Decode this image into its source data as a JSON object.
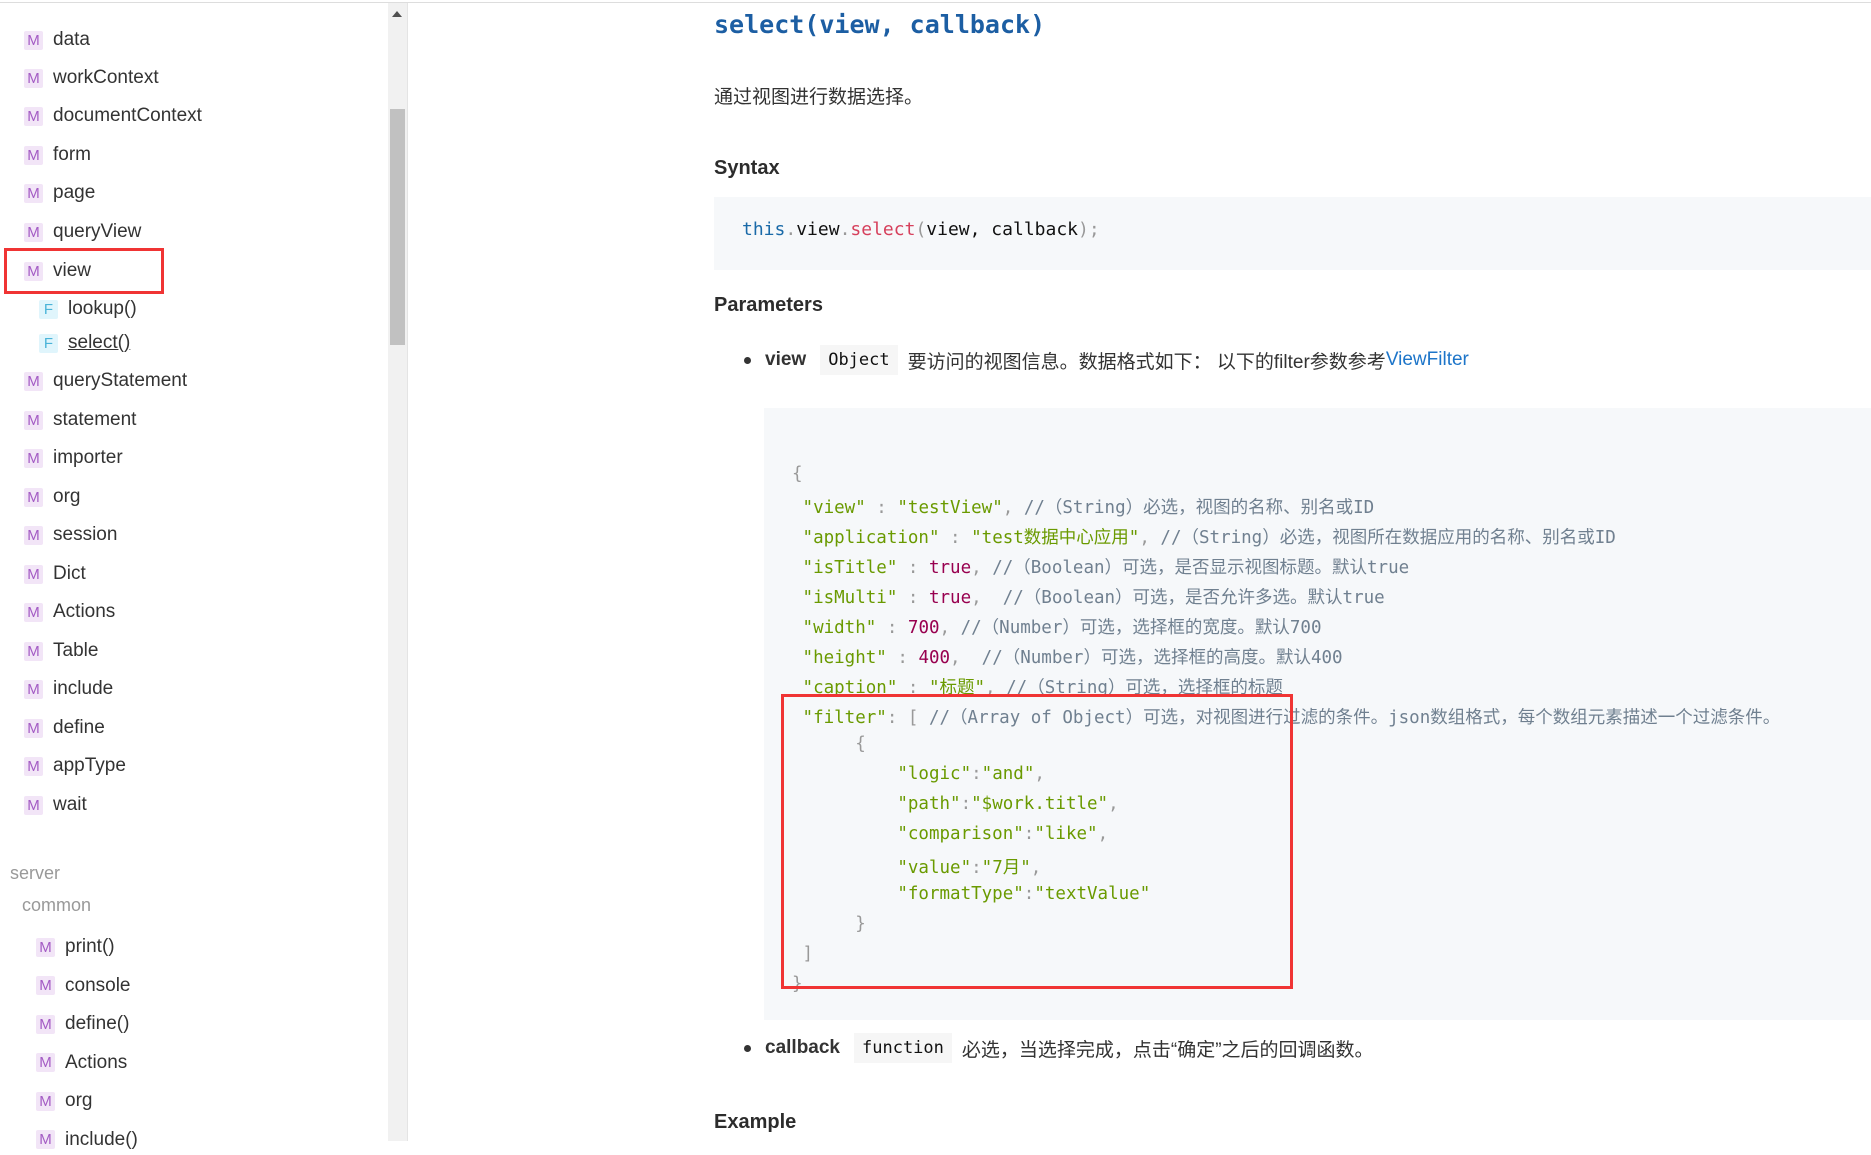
{
  "sidebar": {
    "items": [
      {
        "badge": "M",
        "label": "data"
      },
      {
        "badge": "M",
        "label": "workContext"
      },
      {
        "badge": "M",
        "label": "documentContext"
      },
      {
        "badge": "M",
        "label": "form"
      },
      {
        "badge": "M",
        "label": "page"
      },
      {
        "badge": "M",
        "label": "queryView"
      },
      {
        "badge": "M",
        "label": "view"
      },
      {
        "badge": "F",
        "label": "lookup()"
      },
      {
        "badge": "F",
        "label": "select()"
      },
      {
        "badge": "M",
        "label": "queryStatement"
      },
      {
        "badge": "M",
        "label": "statement"
      },
      {
        "badge": "M",
        "label": "importer"
      },
      {
        "badge": "M",
        "label": "org"
      },
      {
        "badge": "M",
        "label": "session"
      },
      {
        "badge": "M",
        "label": "Dict"
      },
      {
        "badge": "M",
        "label": "Actions"
      },
      {
        "badge": "M",
        "label": "Table"
      },
      {
        "badge": "M",
        "label": "include"
      },
      {
        "badge": "M",
        "label": "define"
      },
      {
        "badge": "M",
        "label": "appType"
      },
      {
        "badge": "M",
        "label": "wait"
      }
    ],
    "server_label": "server",
    "common_label": "common",
    "server_items": [
      {
        "badge": "M",
        "label": "print()"
      },
      {
        "badge": "M",
        "label": "console"
      },
      {
        "badge": "M",
        "label": "define()"
      },
      {
        "badge": "M",
        "label": "Actions"
      },
      {
        "badge": "M",
        "label": "org"
      },
      {
        "badge": "M",
        "label": "include()"
      }
    ],
    "highlight_color": "#f03434"
  },
  "main": {
    "title": "select(view, callback)",
    "description": "通过视图进行数据选择。",
    "syntax_heading": "Syntax",
    "syntax": {
      "this": "this",
      "dot1": ".",
      "obj": "view",
      "dot2": ".",
      "fn": "select",
      "open": "(",
      "args": "view, callback",
      "close": ");"
    },
    "parameters_heading": "Parameters",
    "params": [
      {
        "name": "view",
        "type": "Object",
        "desc": "要访问的视图信息。数据格式如下： 以下的filter参数参考",
        "link": "ViewFilter"
      },
      {
        "name": "callback",
        "type": "function",
        "desc": "必选，当选择完成，点击“确定”之后的回调函数。"
      }
    ],
    "example_heading": "Example",
    "json_lines": [
      [
        [
          "p",
          "{"
        ]
      ],
      [
        [
          "g",
          " \"view\""
        ],
        [
          "p",
          " : "
        ],
        [
          "g",
          "\"testView\""
        ],
        [
          "p",
          ", "
        ],
        [
          "c",
          "//（String）必选，视图的名称、别名或ID"
        ]
      ],
      [
        [
          "g",
          " \"application\""
        ],
        [
          "p",
          " : "
        ],
        [
          "g",
          "\"test数据中心应用\""
        ],
        [
          "p",
          ", "
        ],
        [
          "c",
          "//（String）必选，视图所在数据应用的名称、别名或ID"
        ]
      ],
      [
        [
          "g",
          " \"isTitle\""
        ],
        [
          "p",
          " : "
        ],
        [
          "n",
          "true"
        ],
        [
          "p",
          ", "
        ],
        [
          "c",
          "//（Boolean）可选，是否显示视图标题。默认true"
        ]
      ],
      [
        [
          "g",
          " \"isMulti\""
        ],
        [
          "p",
          " : "
        ],
        [
          "n",
          "true"
        ],
        [
          "p",
          ",  "
        ],
        [
          "c",
          "//（Boolean）可选，是否允许多选。默认true"
        ]
      ],
      [
        [
          "g",
          " \"width\""
        ],
        [
          "p",
          " : "
        ],
        [
          "n",
          "700"
        ],
        [
          "p",
          ", "
        ],
        [
          "c",
          "//（Number）可选，选择框的宽度。默认700"
        ]
      ],
      [
        [
          "g",
          " \"height\""
        ],
        [
          "p",
          " : "
        ],
        [
          "n",
          "400"
        ],
        [
          "p",
          ",  "
        ],
        [
          "c",
          "//（Number）可选，选择框的高度。默认400"
        ]
      ],
      [
        [
          "g",
          " \"caption\""
        ],
        [
          "p",
          " : "
        ],
        [
          "g",
          "\"标题\""
        ],
        [
          "p",
          ", "
        ],
        [
          "c",
          "//（String）可选，选择框的标题"
        ]
      ],
      [
        [
          "g",
          " \"filter\""
        ],
        [
          "p",
          ": [ "
        ],
        [
          "c",
          "//（Array of Object）可选，对视图进行过滤的条件。json数组格式，每个数组元素描述一个过滤条件。"
        ]
      ],
      [
        [
          "p",
          "      {"
        ]
      ],
      [
        [
          "g",
          "          \"logic\""
        ],
        [
          "p",
          ":"
        ],
        [
          "g",
          "\"and\""
        ],
        [
          "p",
          ","
        ]
      ],
      [
        [
          "g",
          "          \"path\""
        ],
        [
          "p",
          ":"
        ],
        [
          "g",
          "\"$work.title\""
        ],
        [
          "p",
          ","
        ]
      ],
      [
        [
          "g",
          "          \"comparison\""
        ],
        [
          "p",
          ":"
        ],
        [
          "g",
          "\"like\""
        ],
        [
          "p",
          ","
        ]
      ],
      [
        [
          "g",
          "          \"value\""
        ],
        [
          "p",
          ":"
        ],
        [
          "g",
          "\"7月\""
        ],
        [
          "p",
          ","
        ]
      ],
      [
        [
          "g",
          "          \"formatType\""
        ],
        [
          "p",
          ":"
        ],
        [
          "g",
          "\"textValue\""
        ]
      ],
      [
        [
          "p",
          "      }"
        ]
      ],
      [
        [
          "p",
          " ]"
        ]
      ],
      [
        [
          "p",
          "}"
        ]
      ]
    ]
  }
}
